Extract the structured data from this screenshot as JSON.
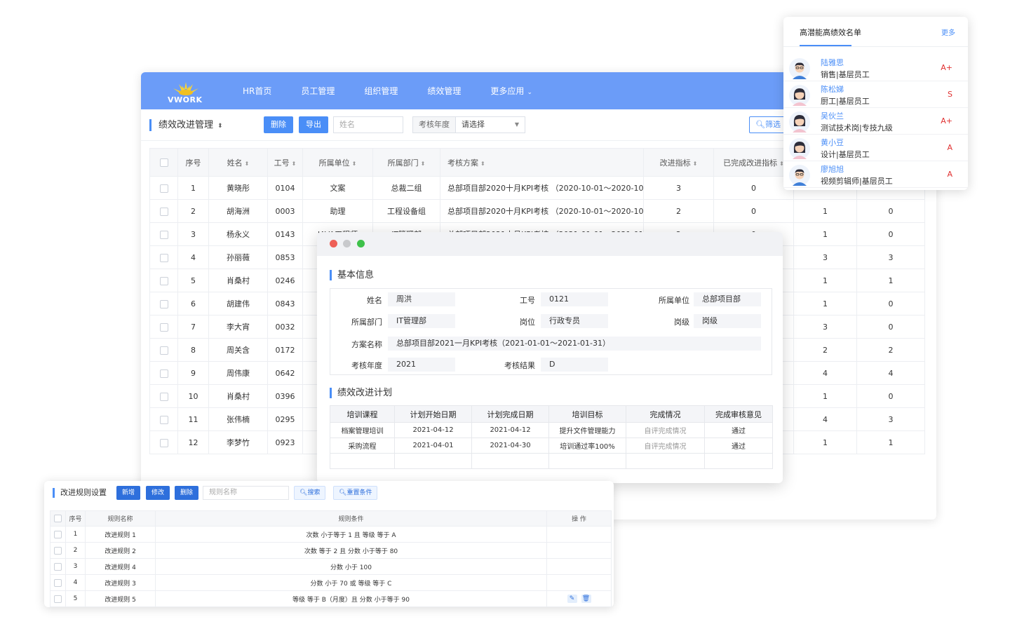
{
  "header": {
    "logo_text": "VWORK",
    "nav": [
      "HR首页",
      "员工管理",
      "组织管理",
      "绩效管理",
      "更多应用"
    ]
  },
  "toolbar": {
    "title": "绩效改进管理",
    "delete_label": "删除",
    "export_label": "导出",
    "name_placeholder": "姓名",
    "year_label": "考核年度",
    "year_select": "请选择",
    "filter_label": "筛选"
  },
  "table": {
    "columns": [
      "序号",
      "姓名",
      "工号",
      "所属单位",
      "所属部门",
      "考核方案",
      "改进指标",
      "已完成改进指标"
    ],
    "rows": [
      {
        "no": "1",
        "name": "黄晓彤",
        "id": "0104",
        "unit": "文案",
        "dept": "总裁二组",
        "plan": "总部项目部2020十月KPI考核 （2020-10-01～2020-10-31）",
        "improve": "3",
        "done": "0",
        "c9": "",
        "c10": ""
      },
      {
        "no": "2",
        "name": "胡海洲",
        "id": "0003",
        "unit": "助理",
        "dept": "工程设备组",
        "plan": "总部项目部2020十月KPI考核 （2020-10-01～2020-10-31）",
        "improve": "2",
        "done": "0",
        "c9": "1",
        "c10": "0"
      },
      {
        "no": "3",
        "name": "杨永义",
        "id": "0143",
        "unit": "JAVA工程师",
        "dept": "IT管理部",
        "plan": "总部项目部2021十月KPI考核 （2021-01-01～2021-01-31）",
        "improve": "2",
        "done": "0",
        "c9": "1",
        "c10": "0"
      },
      {
        "no": "4",
        "name": "孙丽薇",
        "id": "0853",
        "unit": "",
        "dept": "",
        "plan": "",
        "improve": "",
        "done": "",
        "c9": "3",
        "c10": "3"
      },
      {
        "no": "5",
        "name": "肖桑村",
        "id": "0246",
        "unit": "",
        "dept": "",
        "plan": "",
        "improve": "",
        "done": "",
        "c9": "1",
        "c10": "1"
      },
      {
        "no": "6",
        "name": "胡建伟",
        "id": "0843",
        "unit": "",
        "dept": "",
        "plan": "",
        "improve": "",
        "done": "",
        "c9": "1",
        "c10": "0"
      },
      {
        "no": "7",
        "name": "李大宵",
        "id": "0032",
        "unit": "",
        "dept": "",
        "plan": "",
        "improve": "",
        "done": "",
        "c9": "3",
        "c10": "0"
      },
      {
        "no": "8",
        "name": "周关含",
        "id": "0172",
        "unit": "",
        "dept": "",
        "plan": "",
        "improve": "",
        "done": "",
        "c9": "2",
        "c10": "2"
      },
      {
        "no": "9",
        "name": "周伟康",
        "id": "0642",
        "unit": "",
        "dept": "",
        "plan": "",
        "improve": "",
        "done": "",
        "c9": "4",
        "c10": "4"
      },
      {
        "no": "10",
        "name": "肖桑村",
        "id": "0396",
        "unit": "",
        "dept": "",
        "plan": "",
        "improve": "",
        "done": "",
        "c9": "1",
        "c10": "0"
      },
      {
        "no": "11",
        "name": "张伟楠",
        "id": "0295",
        "unit": "",
        "dept": "",
        "plan": "",
        "improve": "",
        "done": "",
        "c9": "4",
        "c10": "3"
      },
      {
        "no": "12",
        "name": "李梦竹",
        "id": "0923",
        "unit": "",
        "dept": "",
        "plan": "",
        "improve": "",
        "done": "",
        "c9": "1",
        "c10": "1"
      }
    ]
  },
  "dialog": {
    "section_basic": "基本信息",
    "fields": {
      "name_label": "姓名",
      "name": "周洪",
      "id_label": "工号",
      "id": "0121",
      "unit_label": "所属单位",
      "unit": "总部项目部",
      "dept_label": "所属部门",
      "dept": "IT管理部",
      "post_label": "岗位",
      "post": "行政专员",
      "level_label": "岗级",
      "level": "岗级",
      "plan_label": "方案名称",
      "plan": "总部项目部2021一月KPI考核（2021-01-01～2021-01-31）",
      "year_label": "考核年度",
      "year": "2021",
      "result_label": "考核结果",
      "result": "D"
    },
    "section_plan": "绩效改进计划",
    "plan_columns": [
      "培训课程",
      "计划开始日期",
      "计划完成日期",
      "培训目标",
      "完成情况",
      "完成审核意见"
    ],
    "plan_rows": [
      {
        "course": "档案管理培训",
        "start": "2021-04-12",
        "end": "2021-04-12",
        "goal": "提升文件管理能力",
        "status": "自评完成情况",
        "review": "通过"
      },
      {
        "course": "采购流程",
        "start": "2021-04-01",
        "end": "2021-04-30",
        "goal": "培训通过率100%",
        "status": "自评完成情况",
        "review": "通过"
      }
    ],
    "colors": {
      "red": "#ee5f57",
      "yellow": "#c8c9cc",
      "green": "#3ec14a"
    }
  },
  "rules": {
    "title": "改进规则设置",
    "add_label": "新增",
    "edit_label": "修改",
    "delete_label": "删除",
    "search_placeholder": "规则名称",
    "search_label": "搜索",
    "reset_label": "重置条件",
    "columns": [
      "序号",
      "规则名称",
      "规则条件",
      "操 作"
    ],
    "rows": [
      {
        "no": "1",
        "name": "改进规则 1",
        "cond": "次数 小于等于 1 且 等级 等于 A"
      },
      {
        "no": "2",
        "name": "改进规则 2",
        "cond": "次数 等于 2 且 分数 小于等于 80"
      },
      {
        "no": "3",
        "name": "改进规则 4",
        "cond": "分数 小于 100"
      },
      {
        "no": "4",
        "name": "改进规则 3",
        "cond": "分数 小于 70 或 等级 等于 C"
      },
      {
        "no": "5",
        "name": "改进规则 5",
        "cond": "等级 等于 B（月度）且 分数 小于等于 90"
      }
    ]
  },
  "talent": {
    "title": "高潜能高绩效名单",
    "more": "更多",
    "people": [
      {
        "name": "陆雅思",
        "role": "销售|基层员工",
        "grade": "A+",
        "avatar": "male-avatar-icon"
      },
      {
        "name": "陈松娣",
        "role": "厨工|基层员工",
        "grade": "S",
        "avatar": "female-avatar-icon"
      },
      {
        "name": "吴伙兰",
        "role": "测试技术岗|专技九级",
        "grade": "A+",
        "avatar": "female-avatar-icon"
      },
      {
        "name": "黄小豆",
        "role": "设计|基层员工",
        "grade": "A",
        "avatar": "female-avatar-icon"
      },
      {
        "name": "廖旭旭",
        "role": "视频剪辑师|基层员工",
        "grade": "A",
        "avatar": "male-avatar-icon"
      }
    ]
  },
  "theme": {
    "accent": "#4a8ef7",
    "topbar": "#6b9cf8",
    "grade_red": "#e03030"
  }
}
